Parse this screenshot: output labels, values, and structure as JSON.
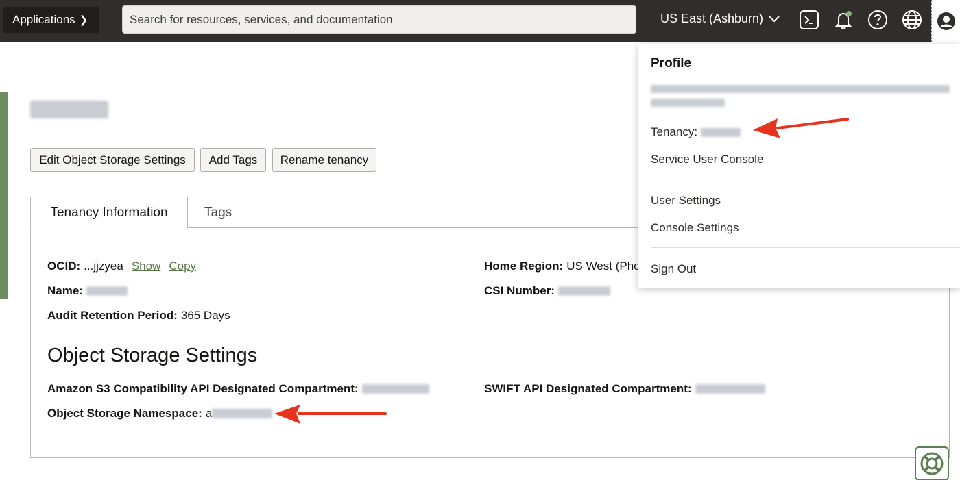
{
  "topbar": {
    "applications_label": "Applications",
    "search_placeholder": "Search for resources, services, and documentation",
    "region_label": "US East (Ashburn)"
  },
  "page": {
    "buttons": {
      "edit_storage": "Edit Object Storage Settings",
      "add_tags": "Add Tags",
      "rename": "Rename tenancy"
    },
    "tabs": {
      "tenancy_info": "Tenancy Information",
      "tags": "Tags"
    },
    "info": {
      "ocid_label": "OCID:",
      "ocid_value": "...jjzyea",
      "show_link": "Show",
      "copy_link": "Copy",
      "name_label": "Name:",
      "audit_label": "Audit Retention Period:",
      "audit_value": "365 Days",
      "home_region_label": "Home Region:",
      "home_region_value": "US West (Phoe",
      "csi_label": "CSI Number:"
    },
    "object_storage": {
      "heading": "Object Storage Settings",
      "s3_label": "Amazon S3 Compatibility API Designated Compartment:",
      "swift_label": "SWIFT API Designated Compartment:",
      "namespace_label": "Object Storage Namespace:",
      "namespace_prefix": "a"
    }
  },
  "profile_menu": {
    "heading": "Profile",
    "tenancy_label": "Tenancy:",
    "service_user_console": "Service User Console",
    "user_settings": "User Settings",
    "console_settings": "Console Settings",
    "sign_out": "Sign Out"
  },
  "colors": {
    "topbar": "#312d2a",
    "accent": "#6b8d5f",
    "link": "#5a7a4e",
    "arrow": "#e8321e"
  }
}
